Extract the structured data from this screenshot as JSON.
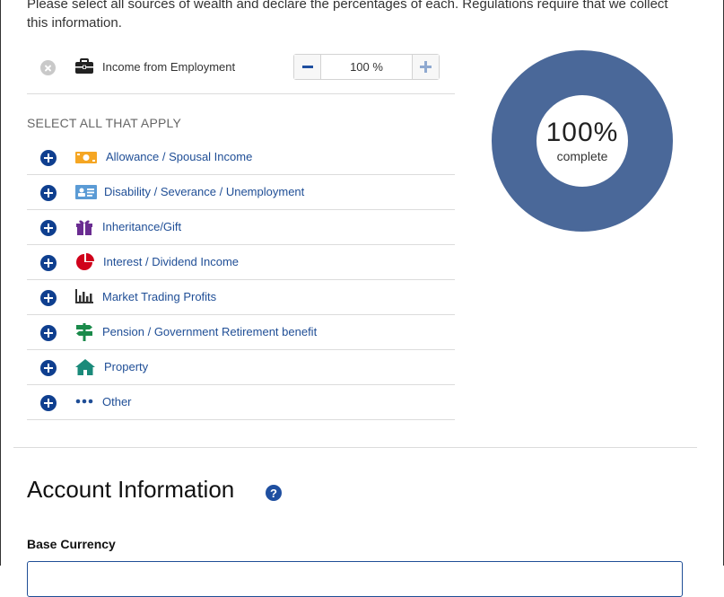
{
  "intro": {
    "text": "Please select all sources of wealth and declare the percentages of each. Regulations require that we collect this information."
  },
  "selected_source": {
    "label": "Income from Employment",
    "icon": "briefcase-icon",
    "percentage": "100 %"
  },
  "select_all": {
    "heading": "SELECT ALL THAT APPLY",
    "options": [
      {
        "label": "Allowance / Spousal Income",
        "icon": "money-icon",
        "color": "#f5a623"
      },
      {
        "label": "Disability / Severance / Unemployment",
        "icon": "id-card-icon",
        "color": "#5b9bd5"
      },
      {
        "label": "Inheritance/Gift",
        "icon": "gift-icon",
        "color": "#6a2c91"
      },
      {
        "label": "Interest / Dividend Income",
        "icon": "pie-chart-icon",
        "color": "#d0021b"
      },
      {
        "label": "Market Trading Profits",
        "icon": "bar-chart-icon",
        "color": "#333333"
      },
      {
        "label": "Pension / Government Retirement benefit",
        "icon": "signpost-icon",
        "color": "#1a8a4a"
      },
      {
        "label": "Property",
        "icon": "house-icon",
        "color": "#1a8a7a"
      },
      {
        "label": "Other",
        "icon": "ellipsis-icon",
        "color": "#1f4e96"
      }
    ]
  },
  "progress": {
    "value": "100%",
    "fraction": 1.0,
    "caption": "complete",
    "color": "#4a6899"
  },
  "account": {
    "title": "Account Information",
    "help": "?",
    "base_currency_label": "Base Currency"
  }
}
